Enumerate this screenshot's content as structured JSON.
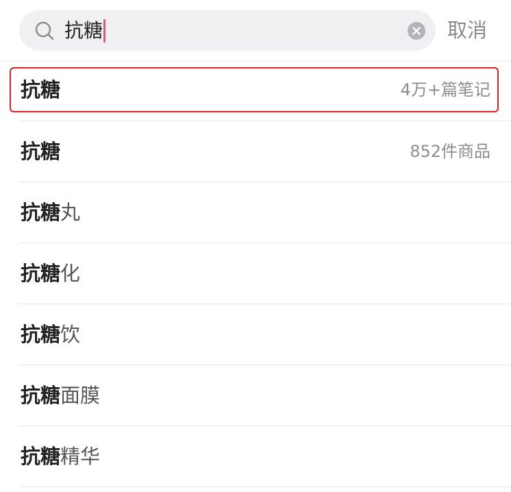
{
  "search": {
    "query": "抗糖",
    "cancel_label": "取消"
  },
  "suggestions": [
    {
      "bold": "抗糖",
      "rest": "",
      "meta": "4万+篇笔记"
    },
    {
      "bold": "抗糖",
      "rest": "",
      "meta": "852件商品"
    },
    {
      "bold": "抗糖",
      "rest": "丸",
      "meta": ""
    },
    {
      "bold": "抗糖",
      "rest": "化",
      "meta": ""
    },
    {
      "bold": "抗糖",
      "rest": "饮",
      "meta": ""
    },
    {
      "bold": "抗糖",
      "rest": "面膜",
      "meta": ""
    },
    {
      "bold": "抗糖",
      "rest": "精华",
      "meta": ""
    }
  ],
  "colors": {
    "caret": "#f0506e",
    "highlight": "#e02020",
    "search_bg": "#f0f0f3"
  },
  "icons": {
    "search": "search-icon",
    "clear": "clear-icon"
  }
}
